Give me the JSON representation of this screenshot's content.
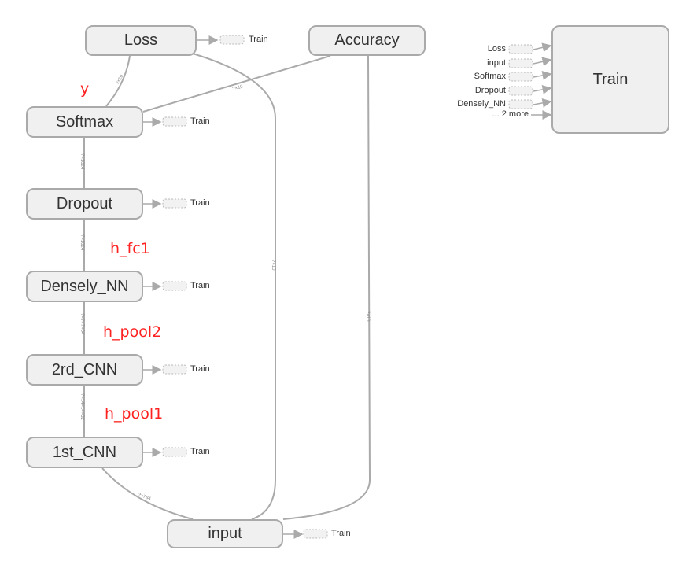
{
  "nodes": {
    "loss": "Loss",
    "accuracy": "Accuracy",
    "softmax": "Softmax",
    "dropout": "Dropout",
    "densely": "Densely_NN",
    "cnn2": "2rd_CNN",
    "cnn1": "1st_CNN",
    "input": "input",
    "train": "Train"
  },
  "aux_label": "Train",
  "train_inputs": [
    "Loss",
    "input",
    "Softmax",
    "Dropout",
    "Densely_NN",
    "... 2 more"
  ],
  "annotations": {
    "y": "y",
    "h_fc1": "h_fc1",
    "h_pool2": "h_pool2",
    "h_pool1": "h_pool1"
  },
  "edge_labels": {
    "loss_softmax": "?×10",
    "acc_softmax": "?×10",
    "softmax_dropout": "?×1024",
    "dropout_dense": "?×1024",
    "dense_cnn2": "?×7×7×64",
    "cnn2_cnn1": "?×14×14×32",
    "cnn1_input": "?×784",
    "loss_input": "?×10",
    "acc_input": "?×10"
  },
  "colors": {
    "node_fill": "#f0f0f0",
    "node_border": "#aaaaaa",
    "edge": "#aaaaaa",
    "annotation": "#ff2020"
  }
}
